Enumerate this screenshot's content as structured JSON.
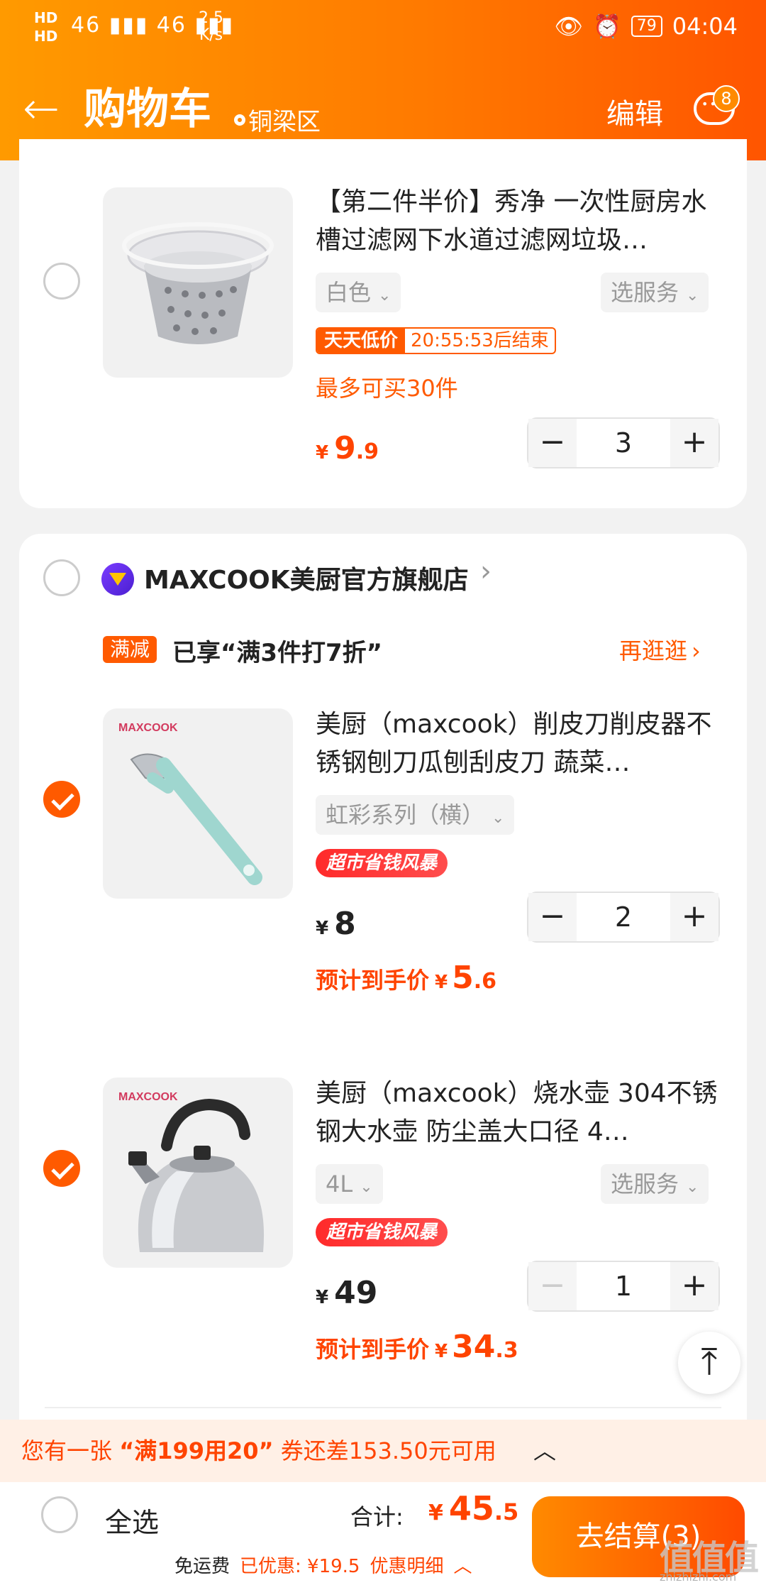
{
  "status_bar": {
    "hd1": "HD",
    "hd2": "HD",
    "signal": "46 ▮▮▮ 46 ▮▮▮",
    "net_speed": "2.5",
    "net_unit": "K/s",
    "battery": "79",
    "time": "04:04"
  },
  "header": {
    "title": "购物车",
    "location": "铜梁区",
    "edit": "编辑",
    "message_count": "8"
  },
  "item1": {
    "title": "【第二件半价】秀净 一次性厨房水槽过滤网下水道过滤网垃圾…",
    "sku": "白色",
    "service": "选服务",
    "deal_tag": "天天低价",
    "countdown": "20:55:53后结束",
    "limit": "最多可买30件",
    "currency": "¥",
    "price_int": "9",
    "price_dec": ".9",
    "quantity": "3",
    "checked": false
  },
  "store": {
    "name": "MAXCOOK美厨官方旗舰店",
    "promo_tag": "满减",
    "promo_text": "已享“满3件打7折”",
    "more": "再逛逛"
  },
  "item2": {
    "title": "美厨（maxcook）削皮刀削皮器不锈钢刨刀瓜刨刮皮刀 蔬菜…",
    "sku": "虹彩系列（横）",
    "badge": "超市省钱风暴",
    "currency": "¥",
    "price_int": "8",
    "est_label": "预计到手价",
    "est_int": "5",
    "est_dec": ".6",
    "quantity": "2",
    "checked": true,
    "brand": "MAXCOOK"
  },
  "item3": {
    "title": "美厨（maxcook）烧水壶 304不锈钢大水壶 防尘盖大口径 4…",
    "sku": "4L",
    "service": "选服务",
    "badge": "超市省钱风暴",
    "currency": "¥",
    "price_int": "49",
    "est_label": "预计到手价",
    "est_int": "34",
    "est_dec": ".3",
    "quantity": "1",
    "checked": true,
    "brand": "MAXCOOK"
  },
  "coupon": {
    "prefix": "您有一张",
    "name": "“满199用20”",
    "suffix": "券还差153.50元可用"
  },
  "footer": {
    "select_all": "全选",
    "total_label": "合计:",
    "currency": "¥",
    "total_int": "45",
    "total_dec": ".5",
    "free_shipping": "免运费",
    "discount": "已优惠: ¥19.5",
    "discount_detail": "优惠明细",
    "checkout": "去结算(3)"
  },
  "watermark": {
    "main": "值值值",
    "sub": "zhizhizhi.com"
  },
  "colors": {
    "accent": "#ff5a00",
    "header_start": "#ff9a00",
    "header_end": "#ff5500",
    "price": "#ff4400"
  }
}
